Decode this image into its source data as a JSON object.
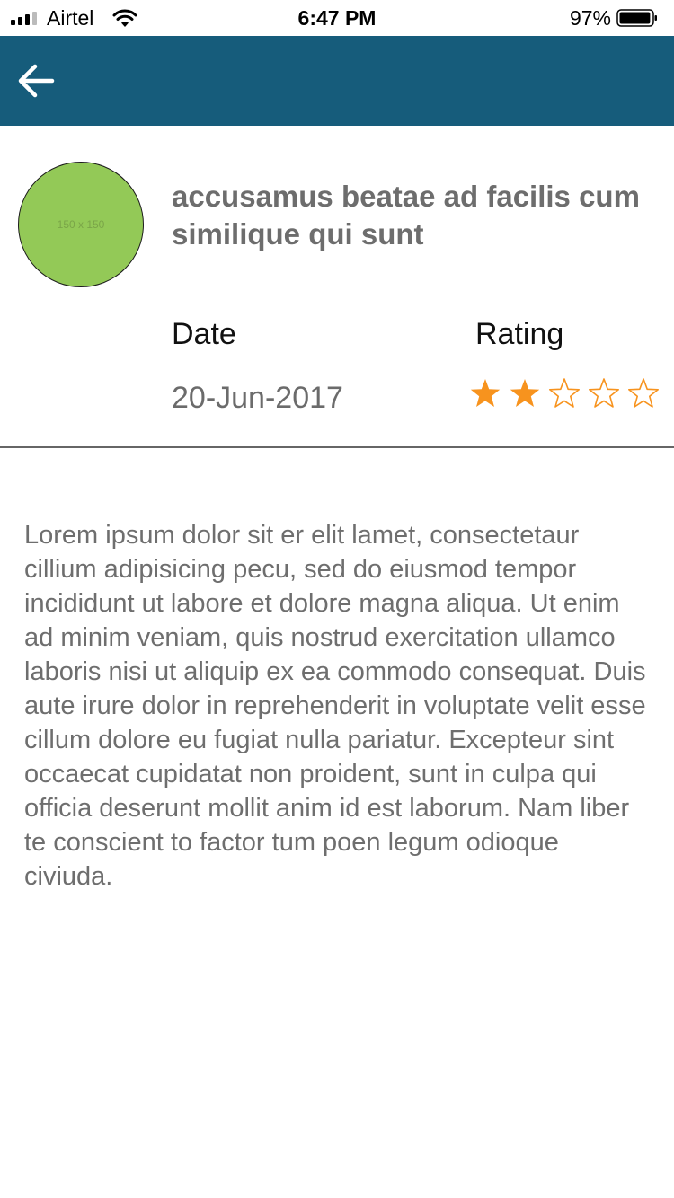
{
  "status_bar": {
    "carrier": "Airtel",
    "time": "6:47 PM",
    "battery_percent": "97%",
    "battery_level": 0.97,
    "signal_bars": 4,
    "signal_bars_active": 3
  },
  "app_bar": {
    "color": "#165c7b",
    "back_icon": "arrow-left-icon"
  },
  "detail": {
    "avatar_placeholder": "150 x 150",
    "avatar_color": "#93c957",
    "title": "accusamus beatae ad facilis cum similique qui sunt",
    "date_label": "Date",
    "date_value": "20-Jun-2017",
    "rating_label": "Rating",
    "rating": 2,
    "rating_max": 5,
    "star_color": "#f7931e"
  },
  "description": "Lorem ipsum dolor sit er elit lamet, consectetaur cillium adipisicing pecu, sed do eiusmod tempor incididunt ut labore et dolore magna aliqua. Ut enim ad minim veniam, quis nostrud exercitation ullamco laboris nisi ut aliquip ex ea commodo consequat. Duis aute irure dolor in reprehenderit in voluptate velit esse cillum dolore eu fugiat nulla pariatur. Excepteur sint occaecat cupidatat non proident, sunt in culpa qui officia deserunt mollit anim id est laborum. Nam liber te conscient to factor tum poen legum odioque civiuda."
}
